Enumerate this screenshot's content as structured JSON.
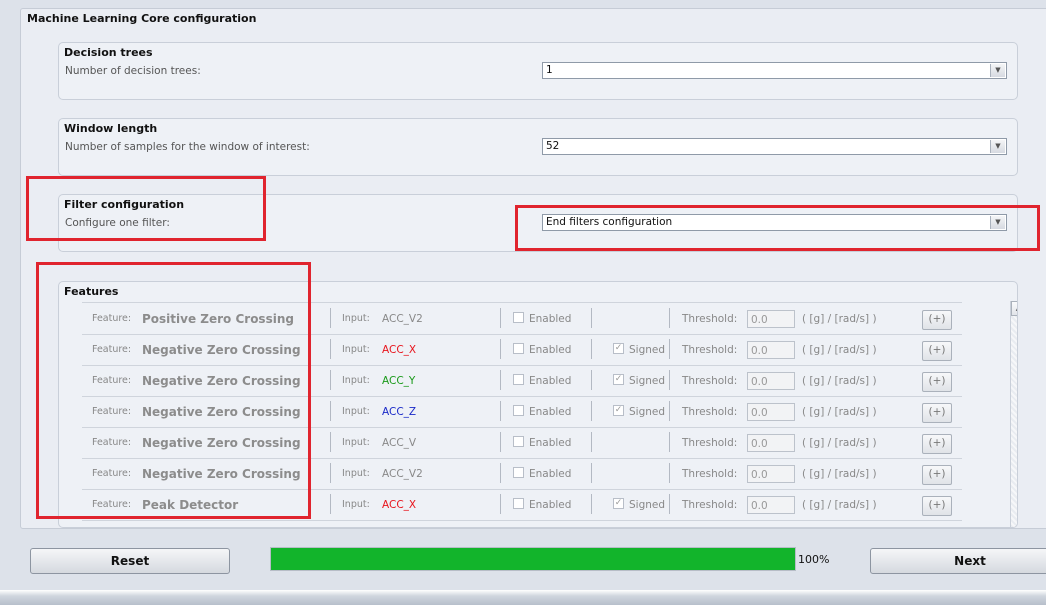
{
  "panel": {
    "title": "Machine Learning Core configuration"
  },
  "decision_trees": {
    "title": "Decision trees",
    "label": "Number of decision trees:",
    "value": "1"
  },
  "window_length": {
    "title": "Window length",
    "label": "Number of samples for the window of interest:",
    "value": "52"
  },
  "filter_configuration": {
    "title": "Filter configuration",
    "label": "Configure one filter:",
    "value": "End filters configuration"
  },
  "features": {
    "title": "Features",
    "feature_label": "Feature:",
    "input_label": "Input:",
    "enabled_label": "Enabled",
    "signed_label": "Signed",
    "threshold_label": "Threshold:",
    "unit_label": "( [g] / [rad/s] )",
    "plus_label": "(+)",
    "rows": [
      {
        "name": "Positive Zero Crossing",
        "input": "ACC_V2",
        "input_color": "#888888",
        "signed": false,
        "enabled": false,
        "threshold": "0.0"
      },
      {
        "name": "Negative Zero Crossing",
        "input": "ACC_X",
        "input_color": "#e8141c",
        "signed": true,
        "enabled": false,
        "threshold": "0.0"
      },
      {
        "name": "Negative Zero Crossing",
        "input": "ACC_Y",
        "input_color": "#1a9a1a",
        "signed": true,
        "enabled": false,
        "threshold": "0.0"
      },
      {
        "name": "Negative Zero Crossing",
        "input": "ACC_Z",
        "input_color": "#1a2ac8",
        "signed": true,
        "enabled": false,
        "threshold": "0.0"
      },
      {
        "name": "Negative Zero Crossing",
        "input": "ACC_V",
        "input_color": "#888888",
        "signed": false,
        "enabled": false,
        "threshold": "0.0"
      },
      {
        "name": "Negative Zero Crossing",
        "input": "ACC_V2",
        "input_color": "#888888",
        "signed": false,
        "enabled": false,
        "threshold": "0.0"
      },
      {
        "name": "Peak Detector",
        "input": "ACC_X",
        "input_color": "#e8141c",
        "signed": true,
        "enabled": false,
        "threshold": "0.0"
      }
    ]
  },
  "footer": {
    "reset_label": "Reset",
    "next_label": "Next",
    "progress_percent": 100,
    "progress_text": "100%",
    "progress_color": "#12b42b"
  },
  "highlight_color": "#e0242e"
}
